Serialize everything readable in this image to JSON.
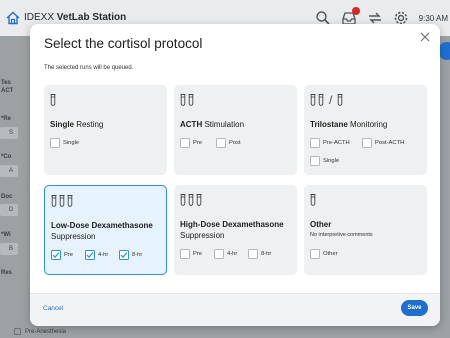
{
  "topbar": {
    "brand": "IDEXX",
    "app_name": "VetLab Station",
    "time": "9:30 AM",
    "icons": [
      "home-icon",
      "search-icon",
      "inbox-icon",
      "sync-icon",
      "gear-icon"
    ]
  },
  "background": {
    "left_labels": [
      "Tes",
      "ACT",
      "*Re",
      "*Co",
      "Doc",
      "*Wi",
      "Res"
    ],
    "left_values": [
      "S",
      "A",
      "D",
      "B"
    ],
    "bottom_check_label": "Pre-Anesthesia"
  },
  "modal": {
    "title": "Select the cortisol protocol",
    "subtitle": "The selected runs will be queued.",
    "cancel_label": "Cancel",
    "save_label": "Save",
    "cards": [
      {
        "name_bold": "Single",
        "name_rest": " Resting",
        "tubes": "1",
        "options": [
          {
            "label": "Single",
            "checked": false
          }
        ]
      },
      {
        "name_bold": "ACTH",
        "name_rest": " Stimulation",
        "tubes": "2",
        "options": [
          {
            "label": "Pre",
            "checked": false
          },
          {
            "label": "Post",
            "checked": false
          }
        ]
      },
      {
        "name_bold": "Trilostane",
        "name_rest": " Monitoring",
        "tubes": "2 / 1",
        "options": [
          {
            "label": "Pre-ACTH",
            "checked": false
          },
          {
            "label": "Post-ACTH",
            "checked": false
          },
          {
            "label": "Single",
            "checked": false
          }
        ]
      },
      {
        "name_bold": "Low-Dose Dexamethasone",
        "name_rest": "Suppression",
        "tubes": "3",
        "selected": true,
        "options": [
          {
            "label": "Pre",
            "checked": true
          },
          {
            "label": "4-hr",
            "checked": true
          },
          {
            "label": "8-hr",
            "checked": true
          }
        ]
      },
      {
        "name_bold": "High-Dose Dexamethasone",
        "name_rest": "Suppression",
        "tubes": "3",
        "options": [
          {
            "label": "Pre",
            "checked": false
          },
          {
            "label": "4-hr",
            "checked": false
          },
          {
            "label": "8-hr",
            "checked": false
          }
        ]
      },
      {
        "name_bold": "Other",
        "name_rest": "",
        "note": "No interpretive comments",
        "tubes": "1",
        "options": [
          {
            "label": "Other",
            "checked": false
          }
        ]
      }
    ]
  },
  "colors": {
    "accent": "#1f6fd1",
    "selected_border": "#2e8fe6",
    "selected_bg": "#e6f2fd",
    "card_bg": "#eef0f1"
  }
}
